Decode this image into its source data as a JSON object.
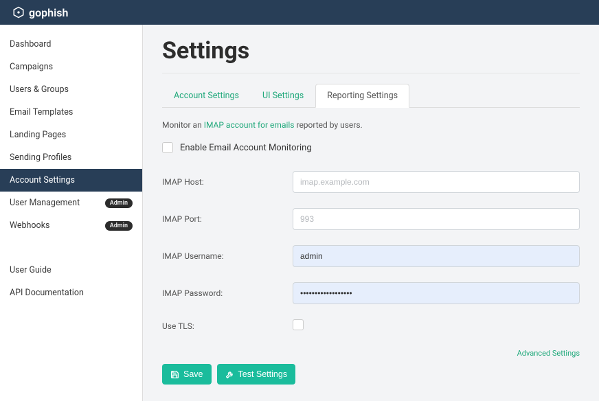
{
  "brand": {
    "name": "gophish"
  },
  "sidebar": {
    "items": [
      {
        "label": "Dashboard"
      },
      {
        "label": "Campaigns"
      },
      {
        "label": "Users & Groups"
      },
      {
        "label": "Email Templates"
      },
      {
        "label": "Landing Pages"
      },
      {
        "label": "Sending Profiles"
      },
      {
        "label": "Account Settings"
      },
      {
        "label": "User Management",
        "badge": "Admin"
      },
      {
        "label": "Webhooks",
        "badge": "Admin"
      }
    ],
    "help": [
      {
        "label": "User Guide"
      },
      {
        "label": "API Documentation"
      }
    ]
  },
  "page": {
    "title": "Settings",
    "tabs": [
      {
        "label": "Account Settings"
      },
      {
        "label": "UI Settings"
      },
      {
        "label": "Reporting Settings"
      }
    ],
    "helper": {
      "prefix": "Monitor an ",
      "link": "IMAP account for emails",
      "suffix": " reported by users."
    },
    "enable_monitoring_label": "Enable Email Account Monitoring",
    "form": {
      "host_label": "IMAP Host:",
      "host_placeholder": "imap.example.com",
      "host_value": "",
      "port_label": "IMAP Port:",
      "port_placeholder": "993",
      "port_value": "",
      "user_label": "IMAP Username:",
      "user_value": "admin",
      "pass_label": "IMAP Password:",
      "pass_value": "••••••••••••••••••",
      "tls_label": "Use TLS:"
    },
    "advanced_label": "Advanced Settings",
    "buttons": {
      "save": "Save",
      "test": "Test Settings"
    }
  }
}
